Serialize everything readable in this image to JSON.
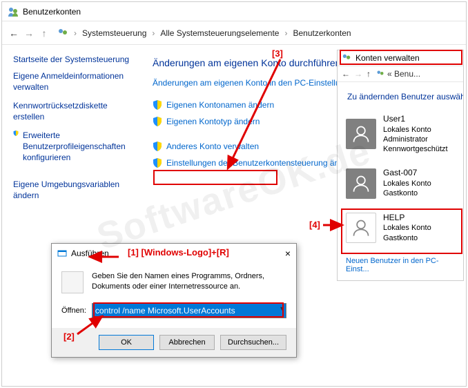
{
  "window": {
    "title": "Benutzerkonten"
  },
  "nav": {
    "breadcrumb": [
      "Systemsteuerung",
      "Alle Systemsteuerungselemente",
      "Benutzerkonten"
    ]
  },
  "sidebar": {
    "home": "Startseite der Systemsteuerung",
    "links": [
      "Eigene Anmeldeinformationen verwalten",
      "Kennwortrücksetzdiskette erstellen",
      "Erweiterte Benutzerprofileigenschaften konfigurieren",
      "Eigene Umgebungsvariablen ändern"
    ]
  },
  "main": {
    "heading": "Änderungen am eigenen Konto durchführen",
    "top_link": "Änderungen am eigenen Konto in den PC-Einstellungen vornehmen",
    "actions": [
      "Eigenen Kontonamen ändern",
      "Eigenen Kontotyp ändern",
      "Anderes Konto verwalten",
      "Einstellungen der Benutzerkontensteuerung ändern"
    ]
  },
  "right_panel": {
    "title": "Konten verwalten",
    "breadcrumb": "« Benu...",
    "heading": "Zu ändernden Benutzer auswählen",
    "users": [
      {
        "name": "User1",
        "type": "Lokales Konto",
        "role": "Administrator",
        "pw": "Kennwortgeschützt"
      },
      {
        "name": "Gast-007",
        "type": "Lokales Konto",
        "role": "Gastkonto",
        "pw": ""
      },
      {
        "name": "HELP",
        "type": "Lokales Konto",
        "role": "Gastkonto",
        "pw": ""
      }
    ],
    "footer": "Neuen Benutzer in den PC-Einst..."
  },
  "run": {
    "title": "Ausführen",
    "desc": "Geben Sie den Namen eines Programms, Ordners, Dokuments oder einer Internetressource an.",
    "open_label": "Öffnen:",
    "value": "control /name Microsoft.UserAccounts",
    "ok": "OK",
    "cancel": "Abbrechen",
    "browse": "Durchsuchen..."
  },
  "annotations": {
    "a1": "[1] [Windows-Logo]+[R]",
    "a2": "[2]",
    "a3": "[3]",
    "a4": "[4]"
  },
  "watermark": "SoftwareOK.de"
}
